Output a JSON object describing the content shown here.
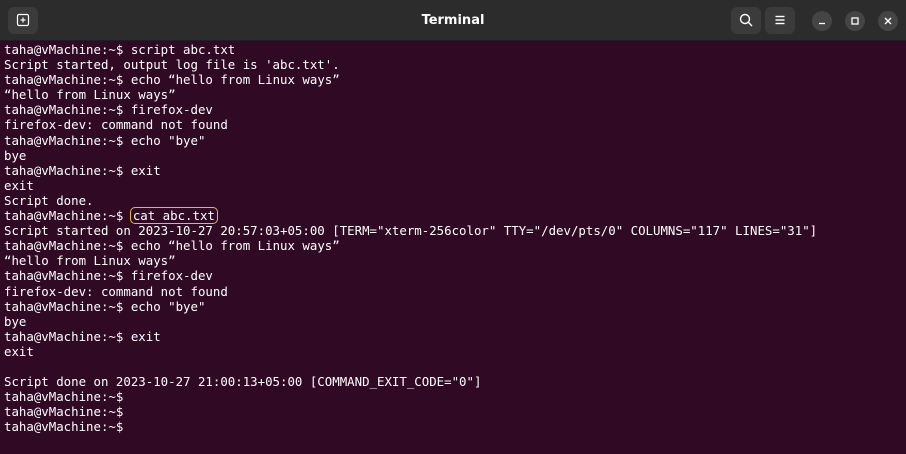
{
  "window": {
    "title": "Terminal",
    "buttons": {
      "new_tab_icon": "new-tab-icon",
      "search_icon": "search-icon",
      "menu_icon": "hamburger-menu-icon",
      "minimize_icon": "minimize-icon",
      "maximize_icon": "maximize-icon",
      "close_icon": "close-icon"
    }
  },
  "terminal": {
    "prompt": "taha@vMachine:~$ ",
    "lines": [
      {
        "type": "cmd",
        "text": "script abc.txt"
      },
      {
        "type": "out",
        "text": "Script started, output log file is 'abc.txt'."
      },
      {
        "type": "cmd",
        "text": "echo “hello from Linux ways”"
      },
      {
        "type": "out",
        "text": "“hello from Linux ways”"
      },
      {
        "type": "cmd",
        "text": "firefox-dev"
      },
      {
        "type": "out",
        "text": "firefox-dev: command not found"
      },
      {
        "type": "cmd",
        "text": "echo \"bye\""
      },
      {
        "type": "out",
        "text": "bye"
      },
      {
        "type": "cmd",
        "text": "exit"
      },
      {
        "type": "out",
        "text": "exit"
      },
      {
        "type": "out",
        "text": "Script done."
      },
      {
        "type": "cmd",
        "text": "cat abc.txt",
        "highlight": true
      },
      {
        "type": "out",
        "text": "Script started on 2023-10-27 20:57:03+05:00 [TERM=\"xterm-256color\" TTY=\"/dev/pts/0\" COLUMNS=\"117\" LINES=\"31\"]"
      },
      {
        "type": "cmd",
        "text": "echo “hello from Linux ways”"
      },
      {
        "type": "out",
        "text": "“hello from Linux ways”"
      },
      {
        "type": "cmd",
        "text": "firefox-dev"
      },
      {
        "type": "out",
        "text": "firefox-dev: command not found"
      },
      {
        "type": "cmd",
        "text": "echo \"bye\""
      },
      {
        "type": "out",
        "text": "bye"
      },
      {
        "type": "cmd",
        "text": "exit"
      },
      {
        "type": "out",
        "text": "exit"
      },
      {
        "type": "out",
        "text": ""
      },
      {
        "type": "out",
        "text": "Script done on 2023-10-27 21:00:13+05:00 [COMMAND_EXIT_CODE=\"0\"]"
      },
      {
        "type": "cmd",
        "text": ""
      },
      {
        "type": "cmd",
        "text": ""
      },
      {
        "type": "cmd",
        "text": ""
      }
    ]
  },
  "colors": {
    "terminal_bg": "#300a24",
    "titlebar_bg": "#2c2c2c",
    "text": "#ffffff",
    "highlight_border": "#e7b73f"
  }
}
